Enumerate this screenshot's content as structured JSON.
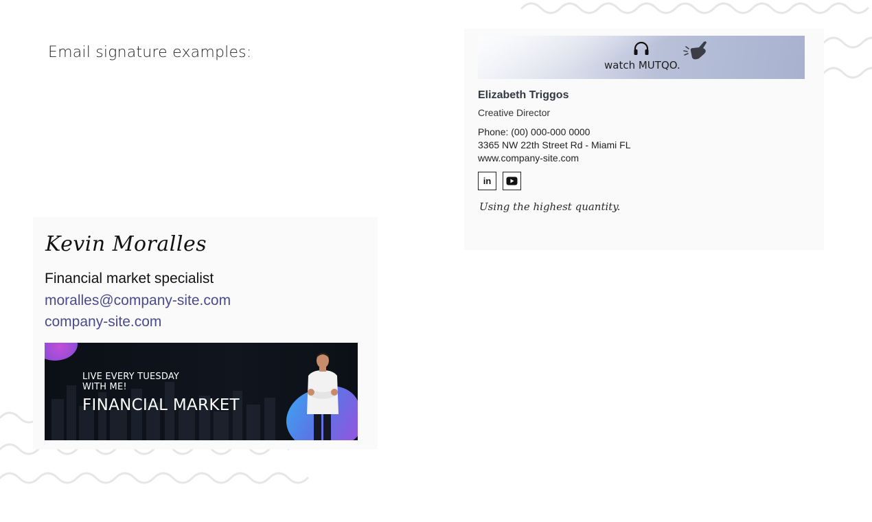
{
  "page": {
    "title": "Email signature examples:"
  },
  "signature_one": {
    "banner_text": "watch MUTQO.",
    "name": "Elizabeth Triggos",
    "role": "Creative Director",
    "phone": "Phone: (00) 000-000 0000",
    "address": "3365 NW 22th Street Rd - Miami FL",
    "website": "www.company-site.com",
    "social": {
      "linkedin_label": "in"
    },
    "tagline": "Using the highest quantity."
  },
  "signature_two": {
    "name": "Kevin Moralles",
    "role": "Financial market specialist",
    "email": "moralles@company-site.com",
    "website": "company-site.com",
    "promo": {
      "line1": "LIVE EVERY TUESDAY",
      "line2": "WITH ME!",
      "title": "FINANCIAL MARKET"
    }
  },
  "colors": {
    "link": "#4a4a8f",
    "wave": "#e6e6e6",
    "promo_background": "#0b0f16"
  }
}
